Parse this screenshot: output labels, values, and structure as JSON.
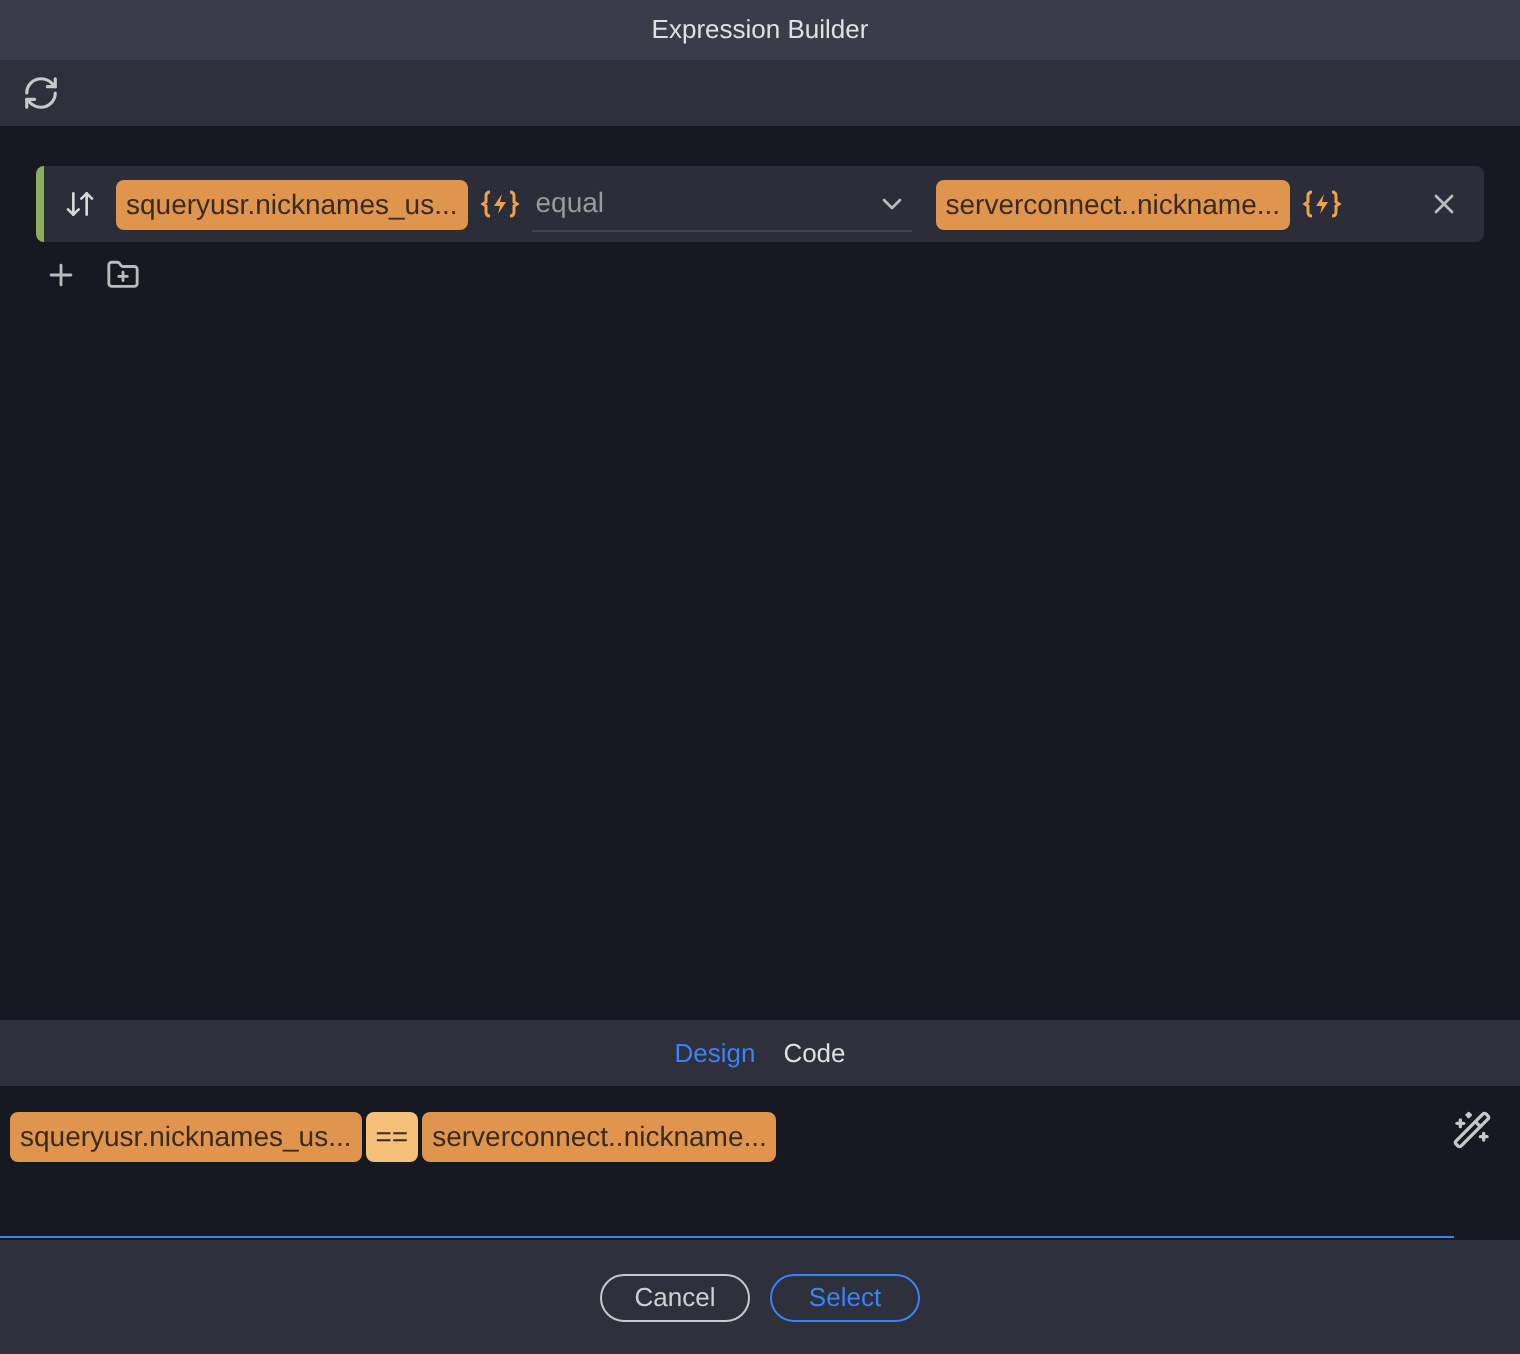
{
  "window": {
    "title": "Expression Builder"
  },
  "condition": {
    "left": "squeryusr.nicknames_us...",
    "operator": "equal",
    "right": "serverconnect..nickname..."
  },
  "tabs": [
    {
      "label": "Design",
      "selected": true
    },
    {
      "label": "Code",
      "selected": false
    }
  ],
  "expression": [
    {
      "kind": "operand",
      "text": "squeryusr.nicknames_us..."
    },
    {
      "kind": "operator",
      "text": "=="
    },
    {
      "kind": "operand",
      "text": "serverconnect..nickname..."
    }
  ],
  "buttons": [
    {
      "label": "Cancel",
      "kind": "secondary"
    },
    {
      "label": "Select",
      "kind": "primary"
    }
  ]
}
